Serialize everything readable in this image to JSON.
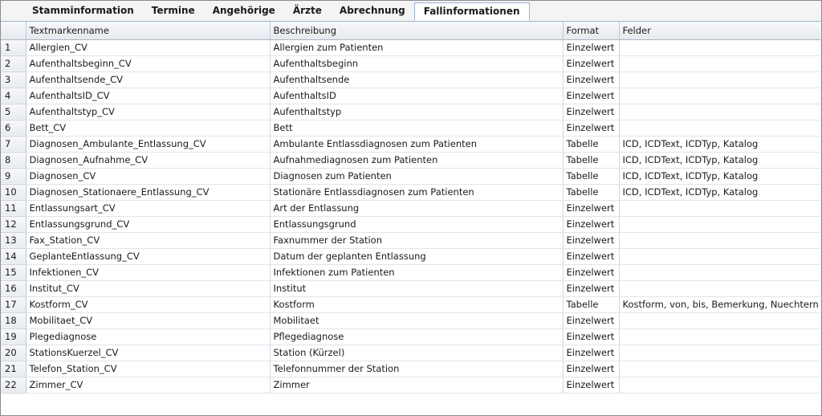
{
  "tabs": [
    {
      "label": "Stamminformation",
      "active": false
    },
    {
      "label": "Termine",
      "active": false
    },
    {
      "label": "Angehörige",
      "active": false
    },
    {
      "label": "Ärzte",
      "active": false
    },
    {
      "label": "Abrechnung",
      "active": false
    },
    {
      "label": "Fallinformationen",
      "active": true
    }
  ],
  "table": {
    "columns": [
      "",
      "Textmarkenname",
      "Beschreibung",
      "Format",
      "Felder"
    ],
    "rows": [
      {
        "index": "1",
        "name": "Allergien_CV",
        "description": "Allergien zum Patienten",
        "format": "Einzelwert",
        "fields": ""
      },
      {
        "index": "2",
        "name": "Aufenthaltsbeginn_CV",
        "description": "Aufenthaltsbeginn",
        "format": "Einzelwert",
        "fields": ""
      },
      {
        "index": "3",
        "name": "Aufenthaltsende_CV",
        "description": "Aufenthaltsende",
        "format": "Einzelwert",
        "fields": ""
      },
      {
        "index": "4",
        "name": "AufenthaltsID_CV",
        "description": "AufenthaltsID",
        "format": "Einzelwert",
        "fields": ""
      },
      {
        "index": "5",
        "name": "Aufenthaltstyp_CV",
        "description": "Aufenthaltstyp",
        "format": "Einzelwert",
        "fields": ""
      },
      {
        "index": "6",
        "name": "Bett_CV",
        "description": "Bett",
        "format": "Einzelwert",
        "fields": ""
      },
      {
        "index": "7",
        "name": "Diagnosen_Ambulante_Entlassung_CV",
        "description": "Ambulante Entlassdiagnosen zum Patienten",
        "format": "Tabelle",
        "fields": "ICD, ICDText, ICDTyp, Katalog"
      },
      {
        "index": "8",
        "name": "Diagnosen_Aufnahme_CV",
        "description": "Aufnahmediagnosen zum Patienten",
        "format": "Tabelle",
        "fields": "ICD, ICDText, ICDTyp, Katalog"
      },
      {
        "index": "9",
        "name": "Diagnosen_CV",
        "description": "Diagnosen zum Patienten",
        "format": "Tabelle",
        "fields": "ICD, ICDText, ICDTyp, Katalog"
      },
      {
        "index": "10",
        "name": "Diagnosen_Stationaere_Entlassung_CV",
        "description": "Stationäre Entlassdiagnosen zum Patienten",
        "format": "Tabelle",
        "fields": "ICD, ICDText, ICDTyp, Katalog"
      },
      {
        "index": "11",
        "name": "Entlassungsart_CV",
        "description": "Art der Entlassung",
        "format": "Einzelwert",
        "fields": ""
      },
      {
        "index": "12",
        "name": "Entlassungsgrund_CV",
        "description": "Entlassungsgrund",
        "format": "Einzelwert",
        "fields": ""
      },
      {
        "index": "13",
        "name": "Fax_Station_CV",
        "description": "Faxnummer der Station",
        "format": "Einzelwert",
        "fields": ""
      },
      {
        "index": "14",
        "name": "GeplanteEntlassung_CV",
        "description": "Datum der geplanten Entlassung",
        "format": "Einzelwert",
        "fields": ""
      },
      {
        "index": "15",
        "name": "Infektionen_CV",
        "description": "Infektionen zum Patienten",
        "format": "Einzelwert",
        "fields": ""
      },
      {
        "index": "16",
        "name": "Institut_CV",
        "description": "Institut",
        "format": "Einzelwert",
        "fields": ""
      },
      {
        "index": "17",
        "name": "Kostform_CV",
        "description": "Kostform",
        "format": "Tabelle",
        "fields": "Kostform, von, bis, Bemerkung, Nuechtern"
      },
      {
        "index": "18",
        "name": "Mobilitaet_CV",
        "description": "Mobilitaet",
        "format": "Einzelwert",
        "fields": ""
      },
      {
        "index": "19",
        "name": "Plegediagnose",
        "description": "Pflegediagnose",
        "format": "Einzelwert",
        "fields": ""
      },
      {
        "index": "20",
        "name": "StationsKuerzel_CV",
        "description": "Station (Kürzel)",
        "format": "Einzelwert",
        "fields": ""
      },
      {
        "index": "21",
        "name": "Telefon_Station_CV",
        "description": "Telefonnummer der Station",
        "format": "Einzelwert",
        "fields": ""
      },
      {
        "index": "22",
        "name": "Zimmer_CV",
        "description": "Zimmer",
        "format": "Einzelwert",
        "fields": ""
      }
    ]
  }
}
